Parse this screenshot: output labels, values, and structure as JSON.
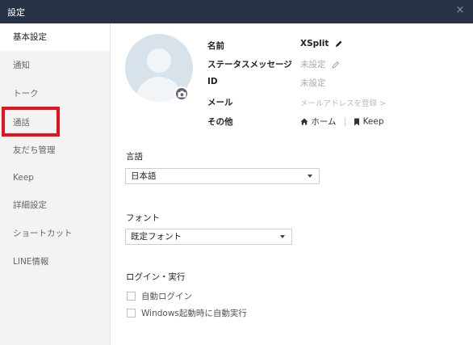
{
  "window": {
    "title": "設定",
    "close_label": "×"
  },
  "sidebar": {
    "items": [
      {
        "label": "基本設定"
      },
      {
        "label": "通知"
      },
      {
        "label": "トーク"
      },
      {
        "label": "通話"
      },
      {
        "label": "友だち管理"
      },
      {
        "label": "Keep"
      },
      {
        "label": "詳細設定"
      },
      {
        "label": "ショートカット"
      },
      {
        "label": "LINE情報"
      }
    ]
  },
  "profile": {
    "name_label": "名前",
    "name_value": "XSplit",
    "status_label": "ステータスメッセージ",
    "status_value": "未設定",
    "id_label": "ID",
    "id_value": "未設定",
    "mail_label": "メール",
    "mail_value": "メールアドレスを登録 >",
    "other_label": "その他",
    "home_link": "ホーム",
    "keep_link": "Keep"
  },
  "language": {
    "label": "言語",
    "value": "日本語"
  },
  "font": {
    "label": "フォント",
    "value": "既定フォント"
  },
  "login": {
    "label": "ログイン・実行",
    "auto_login": "自動ログイン",
    "auto_start": "Windows起動時に自動実行"
  }
}
